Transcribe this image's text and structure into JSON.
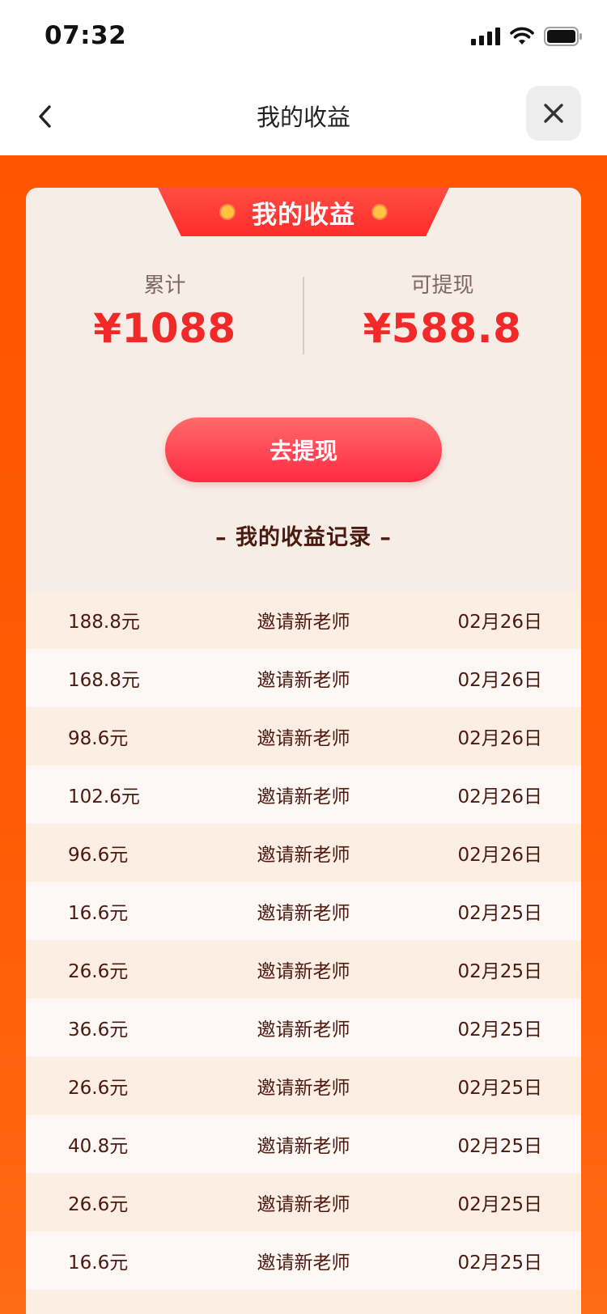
{
  "status_bar": {
    "time": "07:32"
  },
  "nav": {
    "title": "我的收益"
  },
  "card": {
    "tab_title": "我的收益",
    "total_label": "累计",
    "total_value": "¥1088",
    "withdrawable_label": "可提现",
    "withdrawable_value": "¥588.8",
    "withdraw_button": "去提现",
    "records_title": "– 我的收益记录 –"
  },
  "records": [
    {
      "amount": "188.8元",
      "desc": "邀请新老师",
      "date": "02月26日"
    },
    {
      "amount": "168.8元",
      "desc": "邀请新老师",
      "date": "02月26日"
    },
    {
      "amount": "98.6元",
      "desc": "邀请新老师",
      "date": "02月26日"
    },
    {
      "amount": "102.6元",
      "desc": "邀请新老师",
      "date": "02月26日"
    },
    {
      "amount": "96.6元",
      "desc": "邀请新老师",
      "date": "02月26日"
    },
    {
      "amount": "16.6元",
      "desc": "邀请新老师",
      "date": "02月25日"
    },
    {
      "amount": "26.6元",
      "desc": "邀请新老师",
      "date": "02月25日"
    },
    {
      "amount": "36.6元",
      "desc": "邀请新老师",
      "date": "02月25日"
    },
    {
      "amount": "26.6元",
      "desc": "邀请新老师",
      "date": "02月25日"
    },
    {
      "amount": "40.8元",
      "desc": "邀请新老师",
      "date": "02月25日"
    },
    {
      "amount": "26.6元",
      "desc": "邀请新老师",
      "date": "02月25日"
    },
    {
      "amount": "16.6元",
      "desc": "邀请新老师",
      "date": "02月25日"
    },
    {
      "amount": "",
      "desc": "",
      "date": ""
    }
  ],
  "icons": {
    "back": "chevron-left-icon",
    "close": "close-icon",
    "signal": "signal-icon",
    "wifi": "wifi-icon",
    "battery": "battery-icon"
  },
  "colors": {
    "background_orange": "#ff5500",
    "accent_red": "#f22929",
    "button_red": "#ff2a43",
    "card_bg": "#f5ede6",
    "row_odd": "#fdeee3",
    "row_even": "#fdf8f5",
    "text_dark": "#4a1a10"
  }
}
